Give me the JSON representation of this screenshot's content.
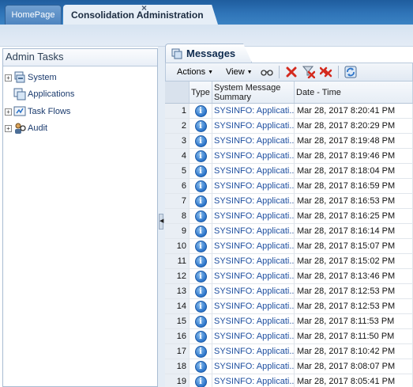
{
  "tabs": {
    "home_label": "HomePage",
    "active_label": "Consolidation Administration",
    "close_glyph": "×"
  },
  "left_panel": {
    "title": "Admin Tasks",
    "items": [
      {
        "label": "System",
        "icon": "system-icon",
        "expandable": true
      },
      {
        "label": "Applications",
        "icon": "applications-icon",
        "expandable": false
      },
      {
        "label": "Task Flows",
        "icon": "task-flows-icon",
        "expandable": true
      },
      {
        "label": "Audit",
        "icon": "audit-icon",
        "expandable": true
      }
    ]
  },
  "right_panel": {
    "tab_label": "Messages",
    "toolbar": {
      "actions_label": "Actions",
      "view_label": "View",
      "icons": [
        "view-glasses-icon",
        "delete-icon",
        "delete-filtered-icon",
        "delete-all-icon",
        "refresh-icon"
      ]
    },
    "table": {
      "headers": {
        "type": "Type",
        "summary": "System Message Summary",
        "date": "Date - Time"
      },
      "rows": [
        {
          "num": "1",
          "summary": "SYSINFO: Applicati...",
          "date": "Mar 28, 2017 8:20:41 PM"
        },
        {
          "num": "2",
          "summary": "SYSINFO: Applicati...",
          "date": "Mar 28, 2017 8:20:29 PM"
        },
        {
          "num": "3",
          "summary": "SYSINFO: Applicati...",
          "date": "Mar 28, 2017 8:19:48 PM"
        },
        {
          "num": "4",
          "summary": "SYSINFO: Applicati...",
          "date": "Mar 28, 2017 8:19:46 PM"
        },
        {
          "num": "5",
          "summary": "SYSINFO: Applicati...",
          "date": "Mar 28, 2017 8:18:04 PM"
        },
        {
          "num": "6",
          "summary": "SYSINFO: Applicati...",
          "date": "Mar 28, 2017 8:16:59 PM"
        },
        {
          "num": "7",
          "summary": "SYSINFO: Applicati...",
          "date": "Mar 28, 2017 8:16:53 PM"
        },
        {
          "num": "8",
          "summary": "SYSINFO: Applicati...",
          "date": "Mar 28, 2017 8:16:25 PM"
        },
        {
          "num": "9",
          "summary": "SYSINFO: Applicati...",
          "date": "Mar 28, 2017 8:16:14 PM"
        },
        {
          "num": "10",
          "summary": "SYSINFO: Applicati...",
          "date": "Mar 28, 2017 8:15:07 PM"
        },
        {
          "num": "11",
          "summary": "SYSINFO: Applicati...",
          "date": "Mar 28, 2017 8:15:02 PM"
        },
        {
          "num": "12",
          "summary": "SYSINFO: Applicati...",
          "date": "Mar 28, 2017 8:13:46 PM"
        },
        {
          "num": "13",
          "summary": "SYSINFO: Applicati...",
          "date": "Mar 28, 2017 8:12:53 PM"
        },
        {
          "num": "14",
          "summary": "SYSINFO: Applicati...",
          "date": "Mar 28, 2017 8:12:53 PM"
        },
        {
          "num": "15",
          "summary": "SYSINFO: Applicati...",
          "date": "Mar 28, 2017 8:11:53 PM"
        },
        {
          "num": "16",
          "summary": "SYSINFO: Applicati...",
          "date": "Mar 28, 2017 8:11:50 PM"
        },
        {
          "num": "17",
          "summary": "SYSINFO: Applicati...",
          "date": "Mar 28, 2017 8:10:42 PM"
        },
        {
          "num": "18",
          "summary": "SYSINFO: Applicati...",
          "date": "Mar 28, 2017 8:08:07 PM"
        },
        {
          "num": "19",
          "summary": "SYSINFO: Applicati...",
          "date": "Mar 28, 2017 8:05:41 PM"
        }
      ]
    }
  },
  "colors": {
    "header_blue": "#2f74b8",
    "link_blue": "#1e4fa0",
    "delete_red": "#d42a1e"
  }
}
